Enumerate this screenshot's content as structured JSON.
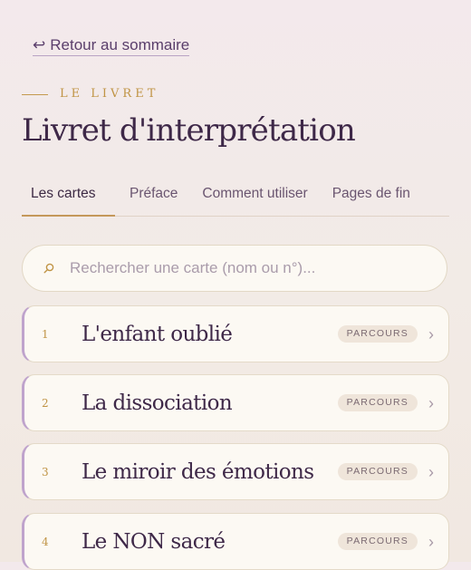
{
  "back": {
    "arrow": "↩",
    "label": "Retour au sommaire"
  },
  "eyebrow": "LE LIVRET",
  "title": "Livret d'interprétation",
  "tabs": [
    {
      "label": "Les cartes",
      "active": true
    },
    {
      "label": "Préface",
      "active": false
    },
    {
      "label": "Comment utiliser",
      "active": false
    },
    {
      "label": "Pages de fin",
      "active": false
    }
  ],
  "search": {
    "placeholder": "Rechercher une carte (nom ou n°)...",
    "icon": "search-icon"
  },
  "cards": [
    {
      "number": "1",
      "title": "L'enfant oublié",
      "badge": "PARCOURS"
    },
    {
      "number": "2",
      "title": "La dissociation",
      "badge": "PARCOURS"
    },
    {
      "number": "3",
      "title": "Le miroir des émotions",
      "badge": "PARCOURS"
    },
    {
      "number": "4",
      "title": "Le NON sacré",
      "badge": "PARCOURS"
    }
  ],
  "colors": {
    "accent_gold": "#c09445",
    "accent_violet": "#bfa3cc",
    "title_ink": "#3e2848"
  }
}
